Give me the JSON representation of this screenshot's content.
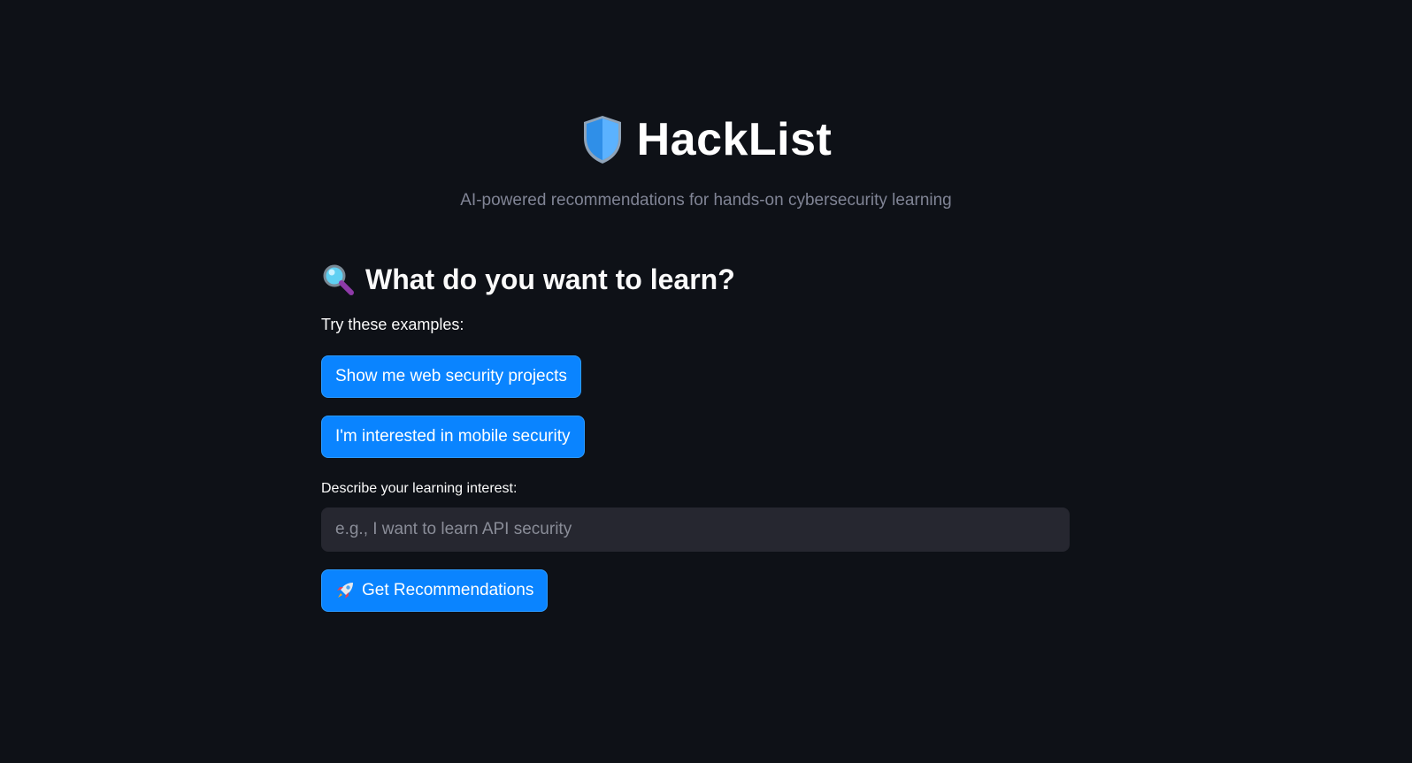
{
  "header": {
    "title": "HackList",
    "subtitle": "AI-powered recommendations for hands-on cybersecurity learning",
    "icon": "shield-icon"
  },
  "section": {
    "heading": "What do you want to learn?",
    "icon": "magnifier-icon"
  },
  "examples": {
    "label": "Try these examples:",
    "items": [
      {
        "label": "Show me web security projects"
      },
      {
        "label": "I'm interested in mobile security"
      }
    ]
  },
  "interest_input": {
    "label": "Describe your learning interest:",
    "placeholder": "e.g., I want to learn API security",
    "value": ""
  },
  "submit": {
    "label": "Get Recommendations",
    "icon": "rocket-icon"
  },
  "colors": {
    "background": "#0e1117",
    "button": "#0a84ff",
    "input_bg": "#262730",
    "muted_text": "#808495"
  }
}
